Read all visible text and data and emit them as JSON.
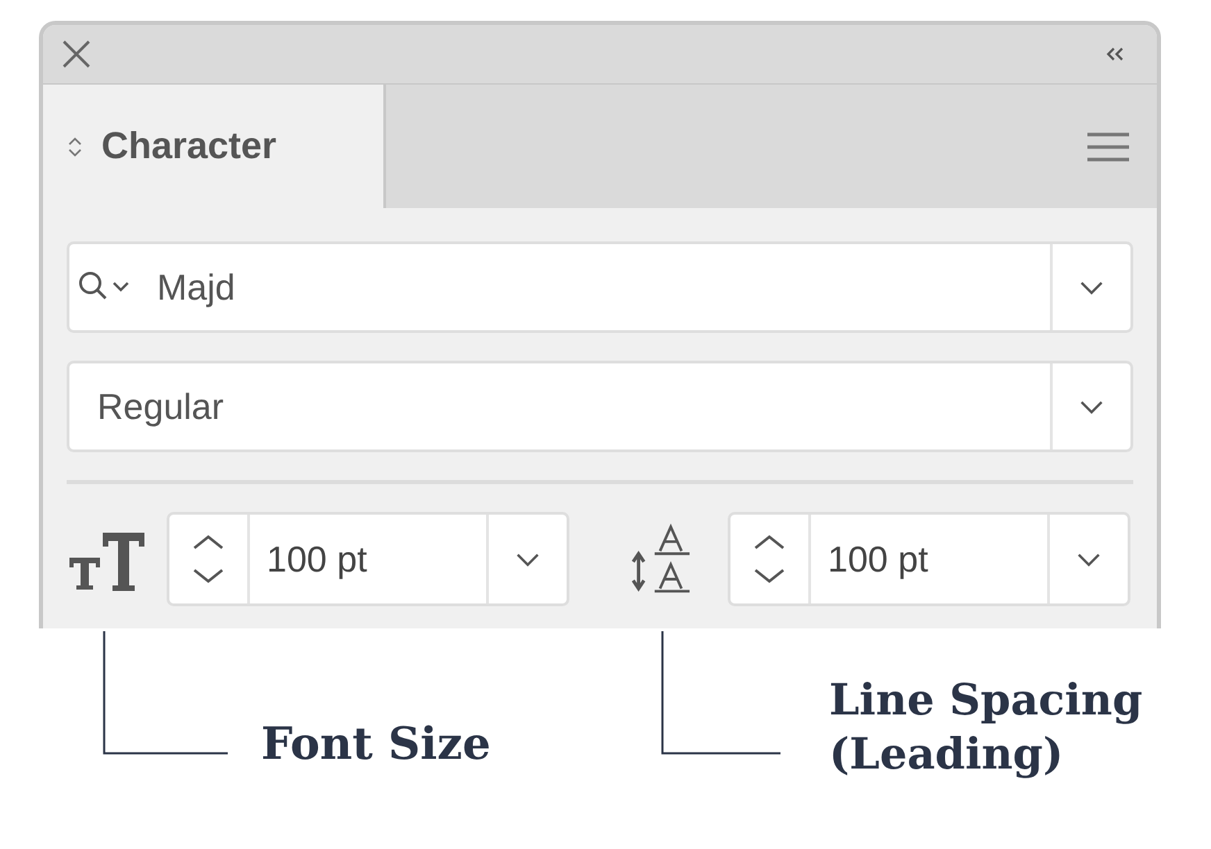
{
  "panel": {
    "tabs": [
      {
        "label": "Character",
        "selected": true
      }
    ],
    "font_family": {
      "value": "Majd"
    },
    "font_style": {
      "value": "Regular"
    },
    "font_size": {
      "value": "100 pt"
    },
    "leading": {
      "value": "100 pt"
    }
  },
  "callouts": [
    {
      "label": "Font Size"
    },
    {
      "label": "Line Spacing (Leading)"
    }
  ]
}
